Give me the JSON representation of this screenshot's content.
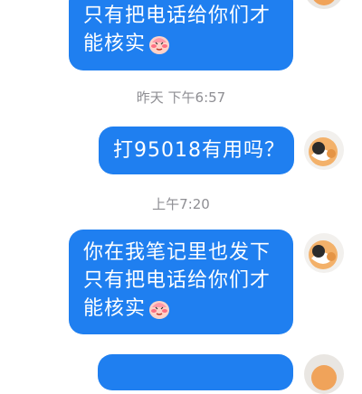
{
  "chat": {
    "messages": [
      {
        "sender": "self",
        "lines": [
          "只有把电话给你们才",
          "能核实"
        ],
        "emoji": "shy-blushing-face-icon"
      },
      {
        "type": "timestamp",
        "text": "昨天 下午6:57"
      },
      {
        "sender": "self",
        "lines": [
          "打95018有用吗？"
        ]
      },
      {
        "type": "timestamp",
        "text": "上午7:20"
      },
      {
        "sender": "self",
        "lines": [
          "你在我笔记里也发下",
          "只有把电话给你们才",
          "能核实"
        ],
        "emoji": "shy-blushing-face-icon"
      }
    ]
  },
  "colors": {
    "bubble": "#1f7ff0",
    "bubble_text": "#ffffff",
    "timestamp_text": "#8e8e93",
    "background": "#ffffff"
  }
}
